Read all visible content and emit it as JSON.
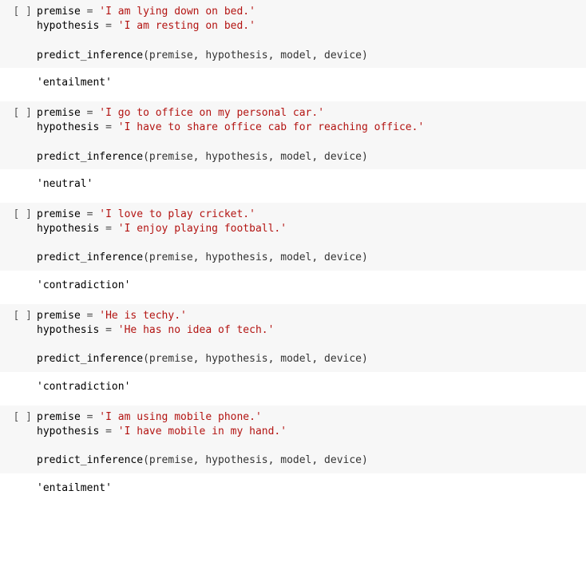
{
  "cells": [
    {
      "lines": [
        [
          [
            "var",
            "premise"
          ],
          [
            "plain",
            " "
          ],
          [
            "eq",
            "="
          ],
          [
            "plain",
            " "
          ],
          [
            "str",
            "'I am lying down on bed.'"
          ]
        ],
        [
          [
            "var",
            "hypothesis"
          ],
          [
            "plain",
            " "
          ],
          [
            "eq",
            "="
          ],
          [
            "plain",
            " "
          ],
          [
            "str",
            "'I am resting on bed.'"
          ]
        ],
        [
          [
            "blank",
            ""
          ]
        ],
        [
          [
            "func",
            "predict_inference"
          ],
          [
            "plain",
            "(premise, hypothesis, model, device)"
          ]
        ]
      ],
      "output": "'entailment'"
    },
    {
      "lines": [
        [
          [
            "var",
            "premise"
          ],
          [
            "plain",
            " "
          ],
          [
            "eq",
            "="
          ],
          [
            "plain",
            " "
          ],
          [
            "str",
            "'I go to office on my personal car.'"
          ]
        ],
        [
          [
            "var",
            "hypothesis"
          ],
          [
            "plain",
            " "
          ],
          [
            "eq",
            "="
          ],
          [
            "plain",
            " "
          ],
          [
            "str",
            "'I have to share office cab for reaching office.'"
          ]
        ],
        [
          [
            "blank",
            ""
          ]
        ],
        [
          [
            "func",
            "predict_inference"
          ],
          [
            "plain",
            "(premise, hypothesis, model, device)"
          ]
        ]
      ],
      "output": "'neutral'"
    },
    {
      "lines": [
        [
          [
            "var",
            "premise"
          ],
          [
            "plain",
            " "
          ],
          [
            "eq",
            "="
          ],
          [
            "plain",
            " "
          ],
          [
            "str",
            "'I love to play cricket.'"
          ]
        ],
        [
          [
            "var",
            "hypothesis"
          ],
          [
            "plain",
            " "
          ],
          [
            "eq",
            "="
          ],
          [
            "plain",
            " "
          ],
          [
            "str",
            "'I enjoy playing football.'"
          ]
        ],
        [
          [
            "blank",
            ""
          ]
        ],
        [
          [
            "func",
            "predict_inference"
          ],
          [
            "plain",
            "(premise, hypothesis, model, device)"
          ]
        ]
      ],
      "output": "'contradiction'"
    },
    {
      "lines": [
        [
          [
            "var",
            "premise"
          ],
          [
            "plain",
            " "
          ],
          [
            "eq",
            "="
          ],
          [
            "plain",
            " "
          ],
          [
            "str",
            "'He is techy.'"
          ]
        ],
        [
          [
            "var",
            "hypothesis"
          ],
          [
            "plain",
            " "
          ],
          [
            "eq",
            "="
          ],
          [
            "plain",
            " "
          ],
          [
            "str",
            "'He has no idea of tech.'"
          ]
        ],
        [
          [
            "blank",
            ""
          ]
        ],
        [
          [
            "func",
            "predict_inference"
          ],
          [
            "plain",
            "(premise, hypothesis, model, device)"
          ]
        ]
      ],
      "output": "'contradiction'"
    },
    {
      "lines": [
        [
          [
            "var",
            "premise"
          ],
          [
            "plain",
            " "
          ],
          [
            "eq",
            "="
          ],
          [
            "plain",
            " "
          ],
          [
            "str",
            "'I am using mobile phone.'"
          ]
        ],
        [
          [
            "var",
            "hypothesis"
          ],
          [
            "plain",
            " "
          ],
          [
            "eq",
            "="
          ],
          [
            "plain",
            " "
          ],
          [
            "str",
            "'I have mobile in my hand.'"
          ]
        ],
        [
          [
            "blank",
            ""
          ]
        ],
        [
          [
            "func",
            "predict_inference"
          ],
          [
            "plain",
            "(premise, hypothesis, model, device)"
          ]
        ]
      ],
      "output": "'entailment'"
    }
  ],
  "prompt": "[ ]"
}
